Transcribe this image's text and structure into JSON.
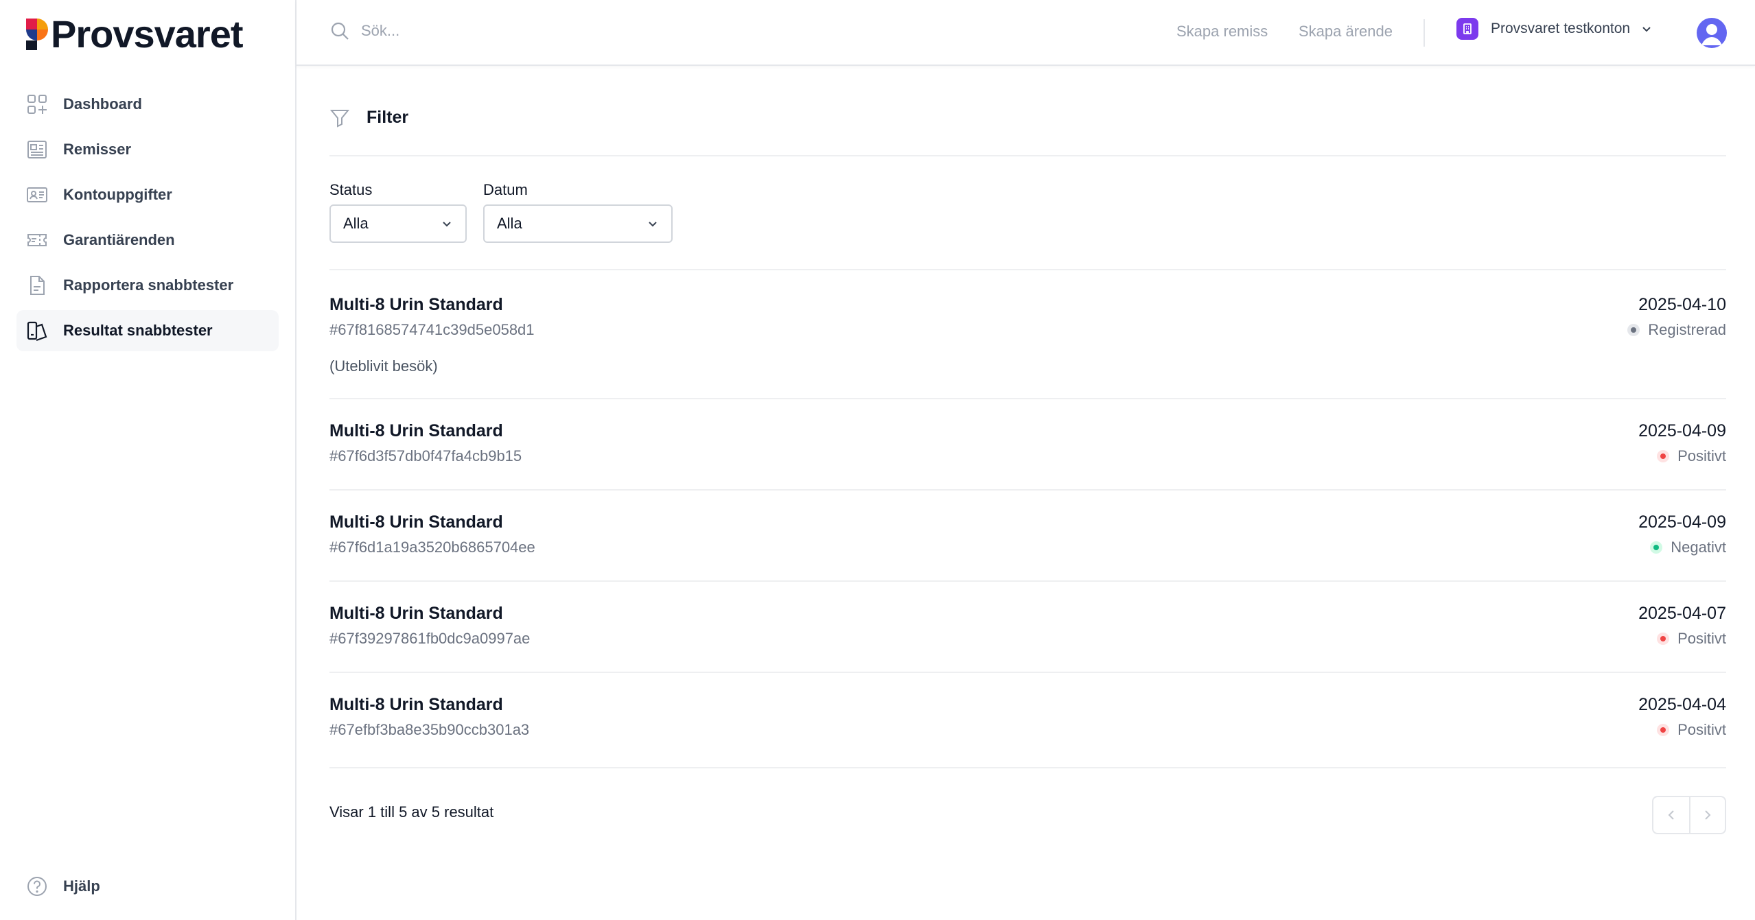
{
  "brand": {
    "name": "Provsvaret"
  },
  "sidebar": {
    "items": [
      {
        "label": "Dashboard",
        "icon": "dashboard-icon",
        "active": false
      },
      {
        "label": "Remisser",
        "icon": "newspaper-icon",
        "active": false
      },
      {
        "label": "Kontouppgifter",
        "icon": "id-card-icon",
        "active": false
      },
      {
        "label": "Garantiärenden",
        "icon": "ticket-icon",
        "active": false
      },
      {
        "label": "Rapportera snabbtester",
        "icon": "document-icon",
        "active": false
      },
      {
        "label": "Resultat snabbtester",
        "icon": "results-icon",
        "active": true
      }
    ],
    "help": {
      "label": "Hjälp",
      "icon": "question-circle-icon"
    }
  },
  "topbar": {
    "search_placeholder": "Sök...",
    "create_referral": "Skapa remiss",
    "create_case": "Skapa ärende",
    "account_name": "Provsvaret testkonton"
  },
  "filter": {
    "title": "Filter",
    "status": {
      "label": "Status",
      "value": "Alla"
    },
    "date": {
      "label": "Datum",
      "value": "Alla"
    }
  },
  "results": [
    {
      "title": "Multi-8 Urin Standard",
      "id": "#67f8168574741c39d5e058d1",
      "note": "(Uteblivit besök)",
      "date": "2025-04-10",
      "status": "Registrerad",
      "status_color": "#6b7280"
    },
    {
      "title": "Multi-8 Urin Standard",
      "id": "#67f6d3f57db0f47fa4cb9b15",
      "note": "",
      "date": "2025-04-09",
      "status": "Positivt",
      "status_color": "#ef4444"
    },
    {
      "title": "Multi-8 Urin Standard",
      "id": "#67f6d1a19a3520b6865704ee",
      "note": "",
      "date": "2025-04-09",
      "status": "Negativt",
      "status_color": "#10b981"
    },
    {
      "title": "Multi-8 Urin Standard",
      "id": "#67f39297861fb0dc9a0997ae",
      "note": "",
      "date": "2025-04-07",
      "status": "Positivt",
      "status_color": "#ef4444"
    },
    {
      "title": "Multi-8 Urin Standard",
      "id": "#67efbf3ba8e35b90ccb301a3",
      "note": "",
      "date": "2025-04-04",
      "status": "Positivt",
      "status_color": "#ef4444"
    }
  ],
  "pagination": {
    "summary": "Visar 1 till 5 av 5 resultat"
  },
  "colors": {
    "accent": "#7c3aed",
    "avatar": "#6366f1",
    "positive": "#ef4444",
    "negative": "#10b981",
    "registered": "#6b7280"
  }
}
